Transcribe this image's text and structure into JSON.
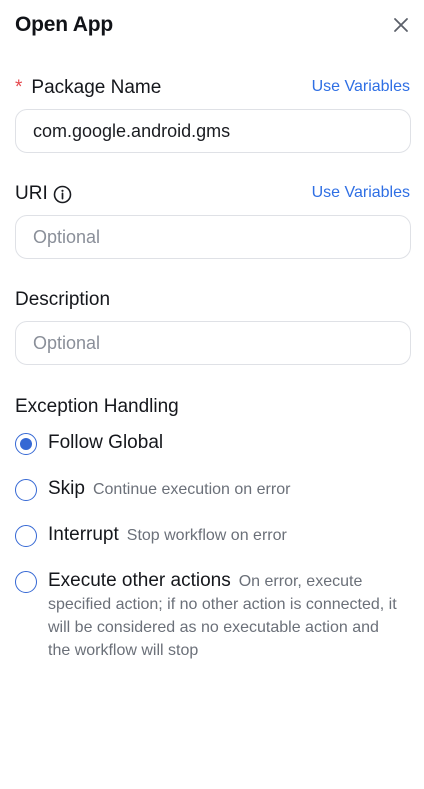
{
  "header": {
    "title": "Open App",
    "close_icon": "close-icon"
  },
  "package": {
    "required_mark": "*",
    "label": "Package Name",
    "use_variables": "Use Variables",
    "value": "com.google.android.gms"
  },
  "uri": {
    "label": "URI",
    "info_icon": "info-icon",
    "use_variables": "Use Variables",
    "placeholder": "Optional"
  },
  "description": {
    "label": "Description",
    "placeholder": "Optional"
  },
  "exception": {
    "label": "Exception Handling",
    "selected": "Follow Global",
    "options": [
      {
        "label": "Follow Global",
        "desc": ""
      },
      {
        "label": "Skip",
        "desc": "Continue execution on error"
      },
      {
        "label": "Interrupt",
        "desc": "Stop workflow on error"
      },
      {
        "label": "Execute other actions",
        "desc_first": "On error, execute",
        "desc_rest": "specified action; if no other action is connected, it will be considered as no executable action and the workflow will stop"
      }
    ]
  },
  "colors": {
    "accent": "#3568d4",
    "link": "#2f6fe4",
    "required": "#e5484d"
  }
}
